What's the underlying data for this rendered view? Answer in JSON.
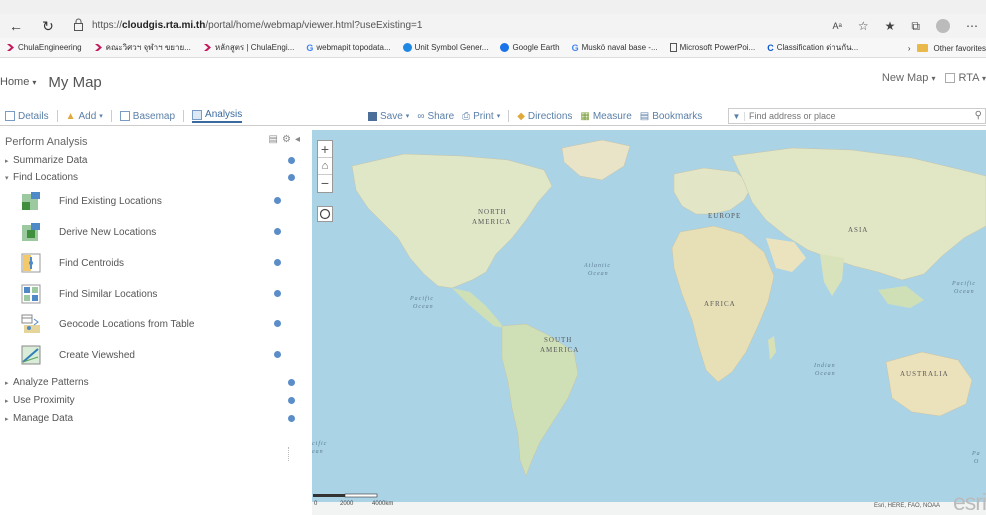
{
  "browser": {
    "url_prefix": "https://",
    "url_host": "cloudgis.rta.mi.th",
    "url_path": "/portal/home/webmap/viewer.html?useExisting=1",
    "reader_icon": "Aᵃ",
    "bookmarks": [
      {
        "label": "ChulaEngineering",
        "icon": "chevron-flag-icon",
        "color": "#c2185b"
      },
      {
        "label": "คณะวิศวฯ จุฬาฯ ขยาย...",
        "icon": "chevron-flag-icon",
        "color": "#c2185b"
      },
      {
        "label": "หลักสูตร | ChulaEngi...",
        "icon": "chevron-flag-icon",
        "color": "#c2185b"
      },
      {
        "label": "webmapit topodata...",
        "icon": "google-icon",
        "color": "#4285f4"
      },
      {
        "label": "Unit Symbol Gener...",
        "icon": "globe-icon",
        "color": "#1e88e5"
      },
      {
        "label": "Google Earth",
        "icon": "google-earth-icon",
        "color": "#1a73e8"
      },
      {
        "label": "Muskö naval base -...",
        "icon": "google-icon",
        "color": "#4285f4"
      },
      {
        "label": "Microsoft PowerPoi...",
        "icon": "page-icon",
        "color": "#555555"
      },
      {
        "label": "Classification ด่านกัน...",
        "icon": "c-icon",
        "color": "#0b57d0"
      }
    ],
    "other_favorites": "Other favorites"
  },
  "header": {
    "home": "Home",
    "map_title": "My Map",
    "new_map": "New Map",
    "user": "RTA"
  },
  "toolbar": {
    "details": "Details",
    "add": "Add",
    "basemap": "Basemap",
    "analysis": "Analysis",
    "save": "Save",
    "share": "Share",
    "print": "Print",
    "directions": "Directions",
    "measure": "Measure",
    "bookmarks": "Bookmarks",
    "search_placeholder": "Find address or place"
  },
  "panel": {
    "title": "Perform Analysis",
    "groups_top": [
      {
        "label": "Summarize Data",
        "expanded": false
      },
      {
        "label": "Find Locations",
        "expanded": true
      }
    ],
    "tools": [
      {
        "label": "Find Existing Locations",
        "icon": "find-existing-locations-icon"
      },
      {
        "label": "Derive New Locations",
        "icon": "derive-new-locations-icon"
      },
      {
        "label": "Find Centroids",
        "icon": "find-centroids-icon"
      },
      {
        "label": "Find Similar Locations",
        "icon": "find-similar-locations-icon"
      },
      {
        "label": "Geocode Locations from Table",
        "icon": "geocode-table-icon"
      },
      {
        "label": "Create Viewshed",
        "icon": "create-viewshed-icon"
      }
    ],
    "groups_bottom": [
      {
        "label": "Analyze Patterns",
        "expanded": false
      },
      {
        "label": "Use Proximity",
        "expanded": false
      },
      {
        "label": "Manage Data",
        "expanded": false
      }
    ]
  },
  "map": {
    "labels": {
      "north_america_1": "NORTH",
      "north_america_2": "AMERICA",
      "europe": "EUROPE",
      "asia": "ASIA",
      "africa": "AFRICA",
      "south_america_1": "SOUTH",
      "south_america_2": "AMERICA",
      "australia": "AUSTRALIA",
      "atlantic_1": "Atlantic",
      "atlantic_2": "Ocean",
      "pacific_1": "Pacific",
      "pacific_2": "Ocean",
      "pacific_right_1": "Pacific",
      "pacific_right_2": "Ocean",
      "indian_1": "Indian",
      "indian_2": "Ocean",
      "pacific_left_partial_1": "cific",
      "pacific_left_partial_2": "ean",
      "pacific_bottom_right_partial_1": "Pa",
      "pacific_bottom_right_partial_2": "O"
    },
    "scale_labels": [
      "0",
      "2000",
      "4000km"
    ],
    "attribution": "Esri, HERE, FAO, NOAA",
    "logo": "esri"
  }
}
